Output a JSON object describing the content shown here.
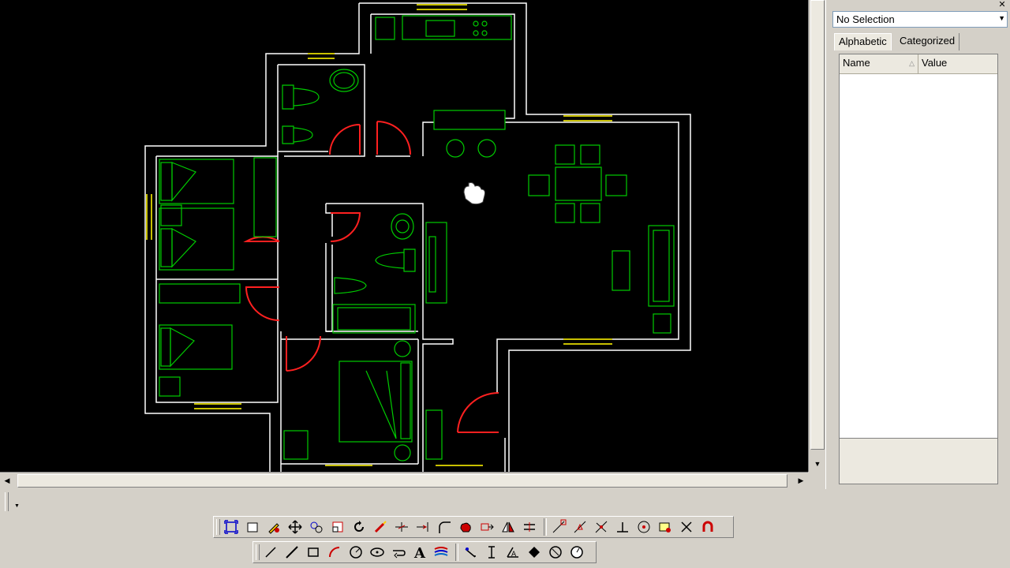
{
  "properties_panel": {
    "selection_value": "No Selection",
    "tabs": [
      {
        "label": "Alphabetic",
        "active": true
      },
      {
        "label": "Categorized",
        "active": false
      }
    ],
    "columns": [
      "Name",
      "Value"
    ]
  },
  "toolbar_top": {
    "icons": [
      "zoom-extents-icon",
      "select-rectangle-icon",
      "edit-pen-icon",
      "move-icon",
      "copy-objects-icon",
      "scale-box-icon",
      "rotate-icon",
      "explode-icon",
      "trim-icon",
      "extend-icon",
      "fillet-icon",
      "pan-hand-icon",
      "stretch-icon",
      "mirror-icon",
      "offset-icon",
      "snap-endpoint-icon",
      "snap-midpoint-icon",
      "snap-intersection-icon",
      "snap-perpendicular-icon",
      "snap-center-icon",
      "snap-node-icon",
      "snap-off-icon",
      "magnet-icon"
    ]
  },
  "toolbar_bottom": {
    "icons": [
      "line-icon",
      "polyline-icon",
      "rectangle-icon",
      "arc-icon",
      "circle-icon",
      "ellipse-icon",
      "wipeout-icon",
      "text-icon",
      "hatch-icon",
      "dimension-aligned-icon",
      "dimension-linear-icon",
      "dimension-angle-icon",
      "point-icon",
      "region-icon",
      "snap-circle-icon"
    ]
  },
  "colors": {
    "canvas": "#000000",
    "walls": "#ffffff",
    "furniture": "#00ff00",
    "doors": "#ff0000",
    "windows": "#c8c000"
  }
}
